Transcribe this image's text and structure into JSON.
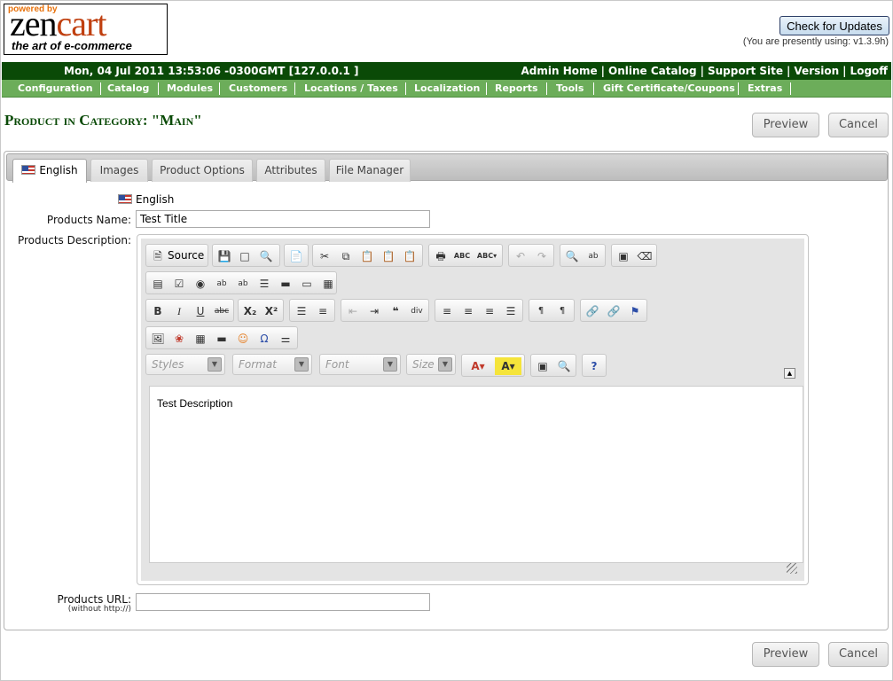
{
  "header": {
    "logo": {
      "powered": "powered by",
      "brand_zen": "zen",
      "brand_cart": "cart",
      "tagline": "the art of e-commerce"
    },
    "check_updates_label": "Check for Updates",
    "version_note": "(You are presently using: v1.3.9h)"
  },
  "topbar": {
    "datetime": "Mon, 04 Jul 2011 13:53:06 -0300GMT [127.0.0.1 ]",
    "links": [
      "Admin Home",
      "Online Catalog",
      "Support Site",
      "Version",
      "Logoff"
    ],
    "separator": "|"
  },
  "menu": [
    "Configuration",
    "Catalog",
    "Modules",
    "Customers",
    "Locations / Taxes",
    "Localization",
    "Reports",
    "Tools",
    "Gift Certificate/Coupons",
    "Extras"
  ],
  "page": {
    "title": "Product in Category: \"Main\"",
    "preview_label": "Preview",
    "cancel_label": "Cancel"
  },
  "tabs": [
    "English",
    "Images",
    "Product Options",
    "Attributes",
    "File Manager"
  ],
  "form": {
    "language": "English",
    "name_label": "Products Name:",
    "name_value": "Test Title",
    "description_label": "Products Description:",
    "url_label": "Products URL:",
    "url_note": "(without http://)",
    "url_value": ""
  },
  "editor": {
    "source_label": "Source",
    "styles_placeholder": "Styles",
    "format_placeholder": "Format",
    "font_placeholder": "Font",
    "size_placeholder": "Size",
    "content": "Test Description"
  },
  "colors": {
    "dark_green": "#0a4a07",
    "menu_green": "#6cad5a"
  }
}
